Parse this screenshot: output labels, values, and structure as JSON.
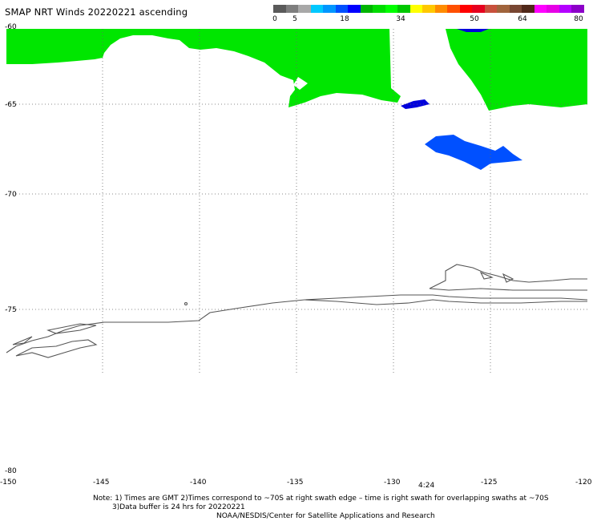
{
  "title": "SMAP NRT Winds 20220221 ascending",
  "colorbar": {
    "segments": [
      "#5a5a5a",
      "#7e7e7e",
      "#a8a8a8",
      "#00c8ff",
      "#0096ff",
      "#0050ff",
      "#0000ff",
      "#00b400",
      "#00dc00",
      "#00ff00",
      "#00c800",
      "#ffff00",
      "#ffc800",
      "#ff8c00",
      "#ff5000",
      "#ff0000",
      "#e6001e",
      "#c8503c",
      "#a0643c",
      "#784632",
      "#502819",
      "#ff00ff",
      "#e600e6",
      "#b400ff",
      "#8c00c8"
    ],
    "labels": [
      "0",
      "5",
      "18",
      "34",
      "50",
      "64",
      "80"
    ]
  },
  "axes": {
    "y_labels": [
      "-60",
      "-65",
      "-70",
      "-75",
      "-80"
    ],
    "x_labels": [
      "-150",
      "-145",
      "-140",
      "-135",
      "-130",
      "-125",
      "-120"
    ]
  },
  "swath_time": "4:24",
  "wind_colors": {
    "moderate": "#00e600",
    "light": "#0050ff",
    "calm": "#0000dc"
  },
  "notes": {
    "line1": "Note: 1) Times are GMT 2)Times correspond to ~70S at right swath edge – time is right swath for overlapping swaths at ~70S",
    "line2": "3)Data buffer is 24 hrs for 20220221",
    "line3": "NOAA/NESDIS/Center for Satellite Applications and Research"
  }
}
